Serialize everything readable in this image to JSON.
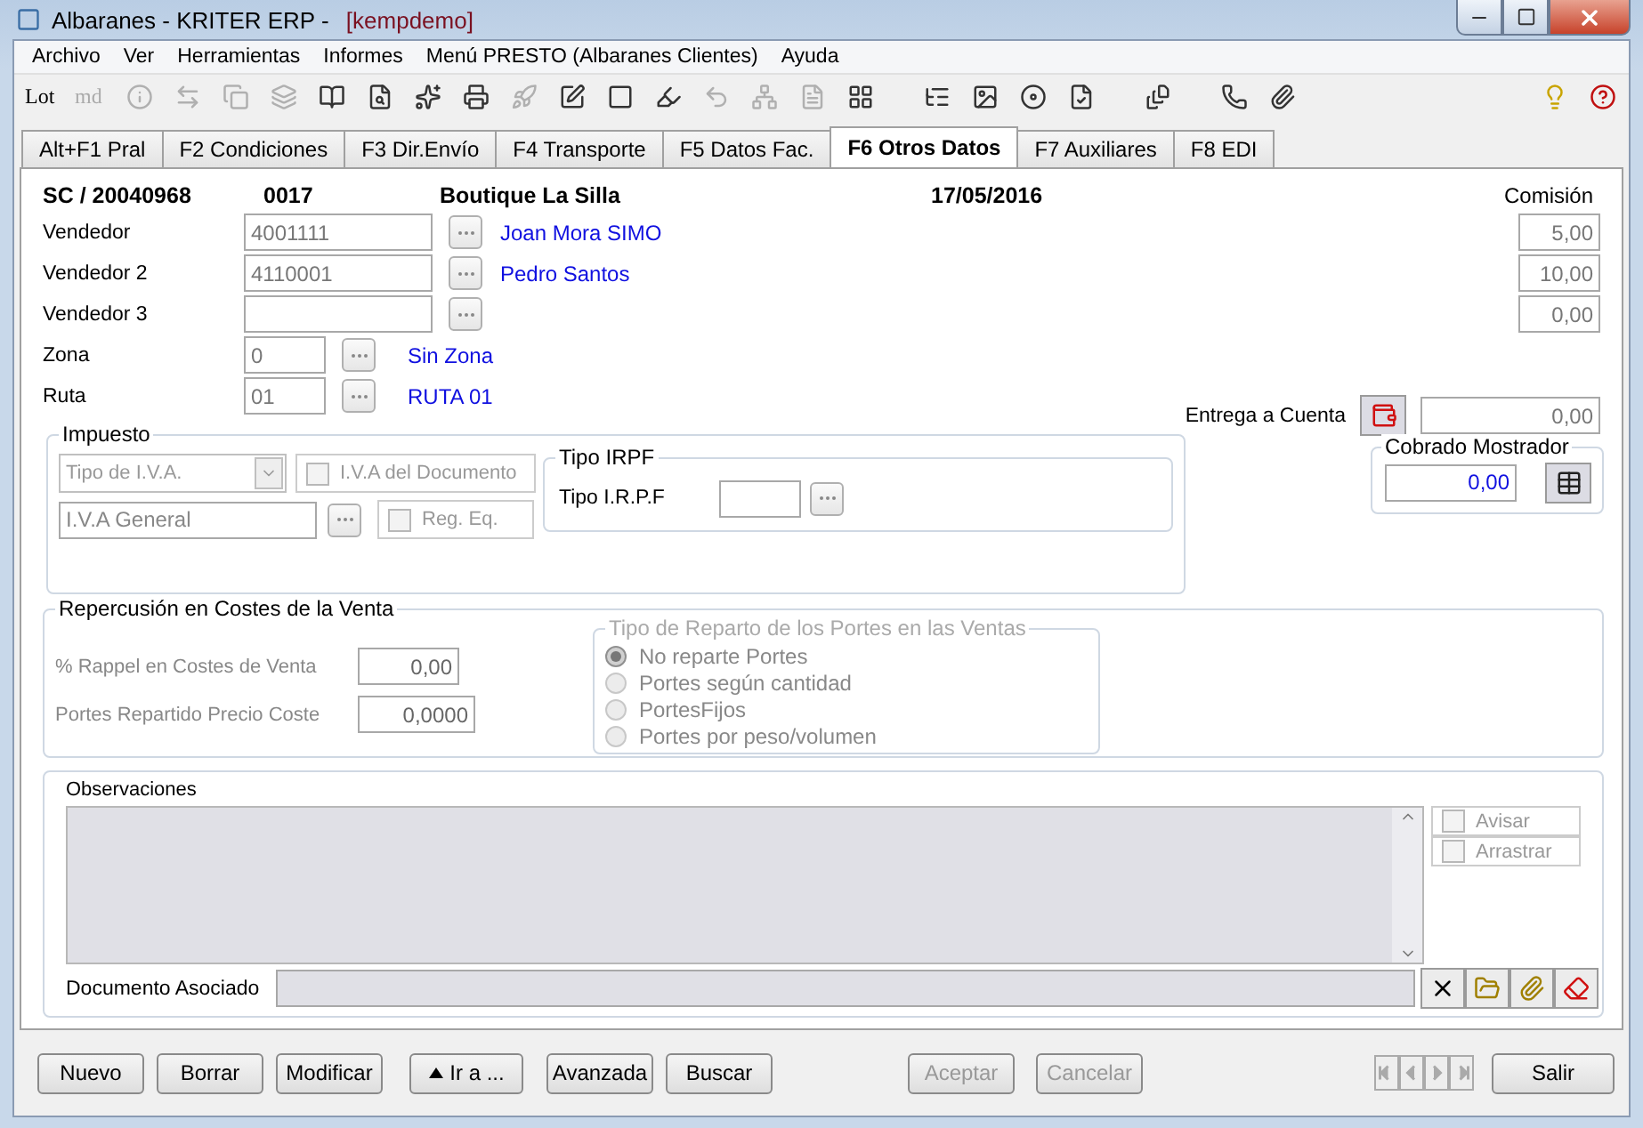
{
  "window": {
    "title": "Albaranes - KRITER ERP - ",
    "user": "[kempdemo]"
  },
  "menu": [
    "Archivo",
    "Ver",
    "Herramientas",
    "Informes",
    "Menú PRESTO (Albaranes Clientes)",
    "Ayuda"
  ],
  "toolbar": {
    "groups": [
      [
        {
          "kind": "text",
          "label": "Lot",
          "disabled": false
        },
        {
          "kind": "text",
          "label": "md",
          "disabled": true
        },
        {
          "kind": "icon",
          "disabled": true
        },
        {
          "kind": "icon",
          "disabled": true
        },
        {
          "kind": "icon",
          "disabled": true
        },
        {
          "kind": "icon",
          "disabled": true
        },
        {
          "kind": "icon",
          "disabled": false
        },
        {
          "kind": "icon",
          "disabled": false
        },
        {
          "kind": "icon",
          "disabled": false
        },
        {
          "kind": "icon",
          "disabled": false
        },
        {
          "kind": "icon",
          "disabled": true
        },
        {
          "kind": "icon",
          "disabled": false
        },
        {
          "kind": "icon",
          "disabled": false
        },
        {
          "kind": "icon",
          "disabled": false
        },
        {
          "kind": "icon",
          "disabled": true
        },
        {
          "kind": "icon",
          "disabled": true
        },
        {
          "kind": "icon",
          "disabled": true
        },
        {
          "kind": "icon",
          "disabled": false
        }
      ],
      [
        {
          "kind": "icon",
          "disabled": false
        },
        {
          "kind": "icon",
          "disabled": false
        },
        {
          "kind": "icon",
          "disabled": false
        },
        {
          "kind": "icon",
          "disabled": false
        }
      ],
      [
        {
          "kind": "icon",
          "disabled": false
        }
      ],
      [
        {
          "kind": "icon",
          "disabled": false
        },
        {
          "kind": "icon",
          "disabled": false
        }
      ]
    ],
    "right": [
      {
        "kind": "icon",
        "disabled": false
      },
      {
        "kind": "icon",
        "disabled": false
      }
    ]
  },
  "tabs": [
    {
      "label": "Alt+F1 Pral",
      "selected": false
    },
    {
      "label": "F2 Condiciones",
      "selected": false
    },
    {
      "label": "F3 Dir.Envío",
      "selected": false
    },
    {
      "label": "F4 Transporte",
      "selected": false
    },
    {
      "label": "F5 Datos Fac.",
      "selected": false
    },
    {
      "label": "F6 Otros Datos",
      "selected": true
    },
    {
      "label": "F7 Auxiliares",
      "selected": false
    },
    {
      "label": "F8 EDI",
      "selected": false
    }
  ],
  "header": {
    "serie": "SC / 20040968",
    "code": "0017",
    "client": "Boutique La Silla",
    "date": "17/05/2016",
    "commission_label": "Comisión"
  },
  "sellers": [
    {
      "label": "Vendedor",
      "code": "4001111",
      "name": "Joan Mora SIMO",
      "commission": "5,00"
    },
    {
      "label": "Vendedor 2",
      "code": "4110001",
      "name": "Pedro Santos",
      "commission": "10,00"
    },
    {
      "label": "Vendedor 3",
      "commission": "0,00"
    }
  ],
  "zones": [
    {
      "label": "Zona",
      "code": "0",
      "name": "Sin Zona"
    },
    {
      "label": "Ruta",
      "code": "01",
      "name": "RUTA 01"
    }
  ],
  "deposit": {
    "label": "Entrega a Cuenta",
    "value": "0,00"
  },
  "counter": {
    "legend": "Cobrado Mostrador",
    "value": "0,00"
  },
  "tax": {
    "legend": "Impuesto",
    "vat_type": {
      "value": "Tipo de I.V.A.",
      "disabled": true
    },
    "doc_vat": {
      "label": "I.V.A del Documento",
      "checked": false,
      "disabled": true
    },
    "vat": {
      "value": "I.V.A General"
    },
    "reg_eq": {
      "label": "Reg. Eq.",
      "checked": false,
      "disabled": true
    },
    "irpf": {
      "legend": "Tipo IRPF",
      "label": "Tipo I.R.P.F"
    }
  },
  "costs": {
    "legend": "Repercusión en Costes de la Venta",
    "disabled": true,
    "fields": [
      {
        "label": "% Rappel en Costes de Venta",
        "value": "0,00"
      },
      {
        "label": "Portes Repartido Precio Coste",
        "value": "0,0000"
      }
    ],
    "shipping": {
      "legend": "Tipo de Reparto de los Portes en las Ventas",
      "disabled": true,
      "options": [
        {
          "label": "No reparte Portes",
          "selected": true
        },
        {
          "label": "Portes según cantidad",
          "selected": false
        },
        {
          "label": "PortesFijos",
          "selected": false
        },
        {
          "label": "Portes por peso/volumen",
          "selected": false
        }
      ]
    }
  },
  "notes": {
    "label": "Observaciones",
    "flags": [
      {
        "label": "Avisar",
        "checked": false,
        "disabled": true
      },
      {
        "label": "Arrastrar",
        "checked": false,
        "disabled": true
      }
    ],
    "document_label": "Documento Asociado"
  },
  "actions": [
    {
      "label": "Nuevo",
      "kind": "plain",
      "disabled": false
    },
    {
      "label": "Borrar",
      "kind": "plain",
      "disabled": false
    },
    {
      "label": "Modificar",
      "kind": "plain",
      "disabled": false
    },
    {
      "label": "Ir a ...",
      "kind": "menu",
      "disabled": false
    },
    {
      "label": "Avanzada",
      "kind": "plain",
      "disabled": false
    },
    {
      "label": "Buscar",
      "kind": "plain",
      "disabled": false
    }
  ],
  "confirm": [
    {
      "label": "Aceptar",
      "disabled": true
    },
    {
      "label": "Cancelar",
      "disabled": true
    }
  ],
  "nav": [
    {
      "kind": "first",
      "disabled": true
    },
    {
      "kind": "prev",
      "disabled": true
    },
    {
      "kind": "next",
      "disabled": true
    },
    {
      "kind": "last",
      "disabled": true
    }
  ],
  "exit": {
    "label": "Salir"
  }
}
